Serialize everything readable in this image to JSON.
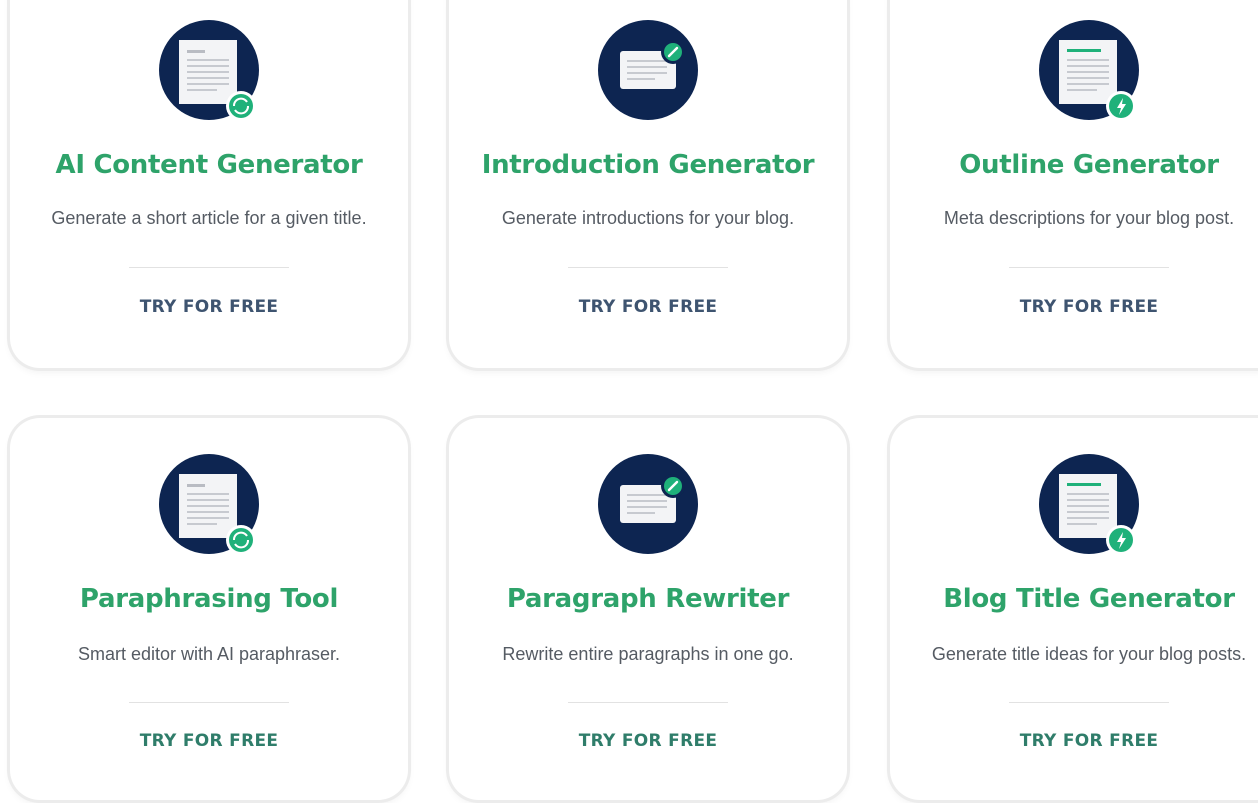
{
  "colors": {
    "title_green": "#2ea36a",
    "icon_navy": "#0d2551",
    "badge_green": "#1fb17a",
    "cta_row1": "#3e5470",
    "cta_row2": "#2f7d6a",
    "description": "#555b63"
  },
  "cards": [
    {
      "title": "AI Content Generator",
      "description": "Generate a short article for a given title.",
      "cta": "TRY FOR FREE",
      "icon": "document-refresh-icon"
    },
    {
      "title": "Introduction Generator",
      "description": "Generate introductions for your blog.",
      "cta": "TRY FOR FREE",
      "icon": "edit-window-icon"
    },
    {
      "title": "Outline Generator",
      "description": "Meta descriptions for your blog post.",
      "cta": "TRY FOR FREE",
      "icon": "document-bolt-icon"
    },
    {
      "title": "Paraphrasing Tool",
      "description": "Smart editor with AI paraphraser.",
      "cta": "TRY FOR FREE",
      "icon": "document-refresh-icon"
    },
    {
      "title": "Paragraph Rewriter",
      "description": "Rewrite entire paragraphs in one go.",
      "cta": "TRY FOR FREE",
      "icon": "edit-window-icon"
    },
    {
      "title": "Blog Title Generator",
      "description": "Generate title ideas for your blog posts.",
      "cta": "TRY FOR FREE",
      "icon": "document-bolt-icon"
    }
  ]
}
